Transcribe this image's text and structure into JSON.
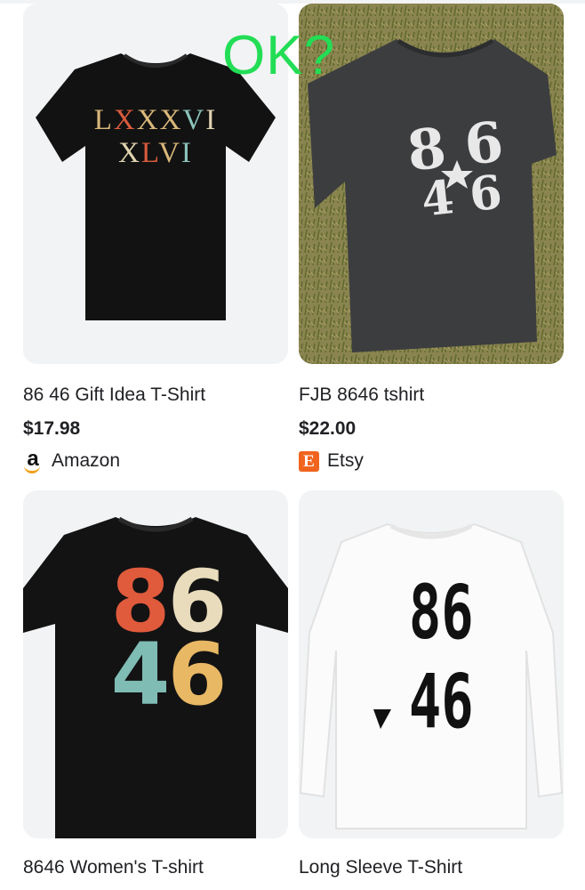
{
  "overlay": {
    "text": "OK?"
  },
  "products": [
    {
      "title": "86 46 Gift Idea T-Shirt",
      "price": "$17.98",
      "merchant": "Amazon",
      "merchant_icon": "amazon-logo-icon",
      "shirt_print": [
        "LXXXVI",
        "XLVI"
      ]
    },
    {
      "title": "FJB 8646 tshirt",
      "price": "$22.00",
      "merchant": "Etsy",
      "merchant_icon": "etsy-logo-icon",
      "shirt_print": [
        "86",
        "46"
      ]
    },
    {
      "title": "8646 Women's T-shirt",
      "shirt_print": [
        "86",
        "46"
      ]
    },
    {
      "title": "Long Sleeve T-Shirt",
      "shirt_print": [
        "86",
        "46"
      ]
    }
  ],
  "colors": {
    "etsy_orange": "#f1641e",
    "amazon_orange": "#f0a11a",
    "overlay_green": "#22dd55",
    "card_bg": "#f1f3f4"
  }
}
